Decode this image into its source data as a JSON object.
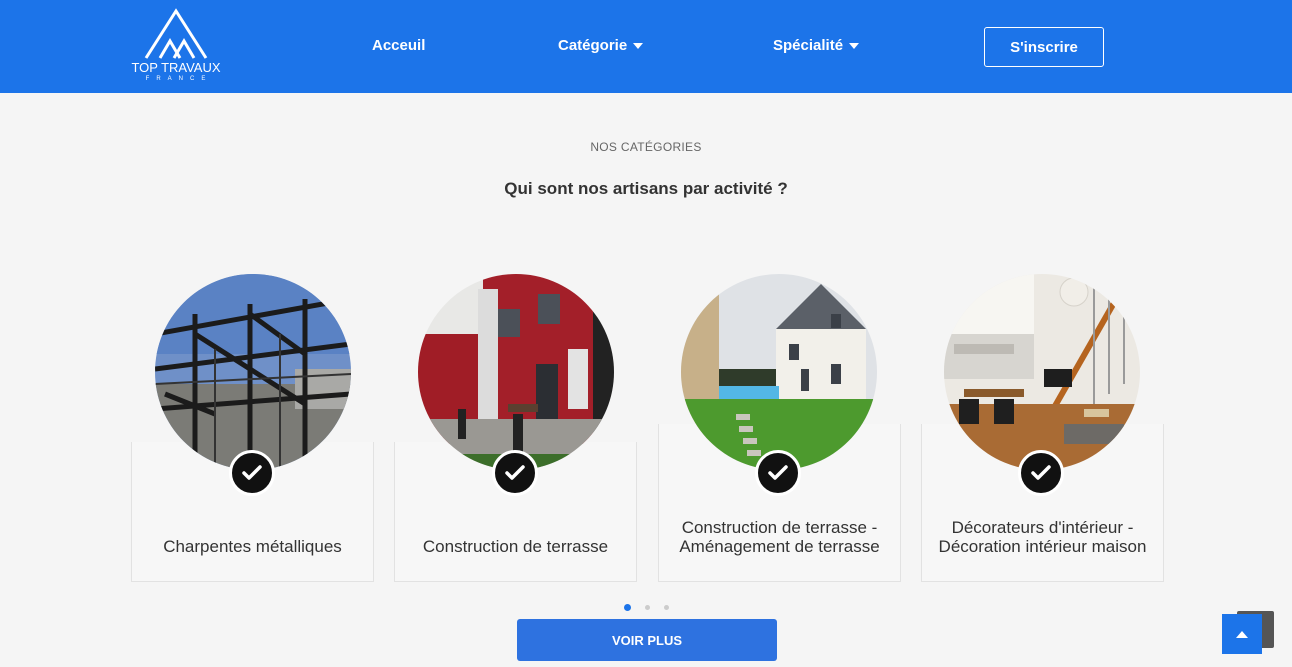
{
  "brand": {
    "name": "TOP TRAVAUX",
    "country": "FRANCE"
  },
  "nav": {
    "home": "Acceuil",
    "category": "Catégorie",
    "specialty": "Spécialité",
    "signup": "S'inscrire"
  },
  "section": {
    "eyebrow": "NOS CATÉGORIES",
    "heading": "Qui sont nos artisans par activité ?"
  },
  "cards": [
    {
      "line1": "Charpentes métalliques",
      "line2": ""
    },
    {
      "line1": "Construction de terrasse",
      "line2": ""
    },
    {
      "line1": "Construction de terrasse -",
      "line2": "Aménagement de terrasse"
    },
    {
      "line1": "Décorateurs d'intérieur -",
      "line2": "Décoration intérieur maison"
    }
  ],
  "carousel": {
    "page_count": 3,
    "active_page": 1
  },
  "actions": {
    "see_more": "VOIR PLUS"
  },
  "colors": {
    "primary": "#1c74e9",
    "button": "#2e72e0",
    "check_bg": "#111111"
  },
  "icons": [
    "chevron-down-icon",
    "check-icon",
    "arrow-up-icon"
  ]
}
